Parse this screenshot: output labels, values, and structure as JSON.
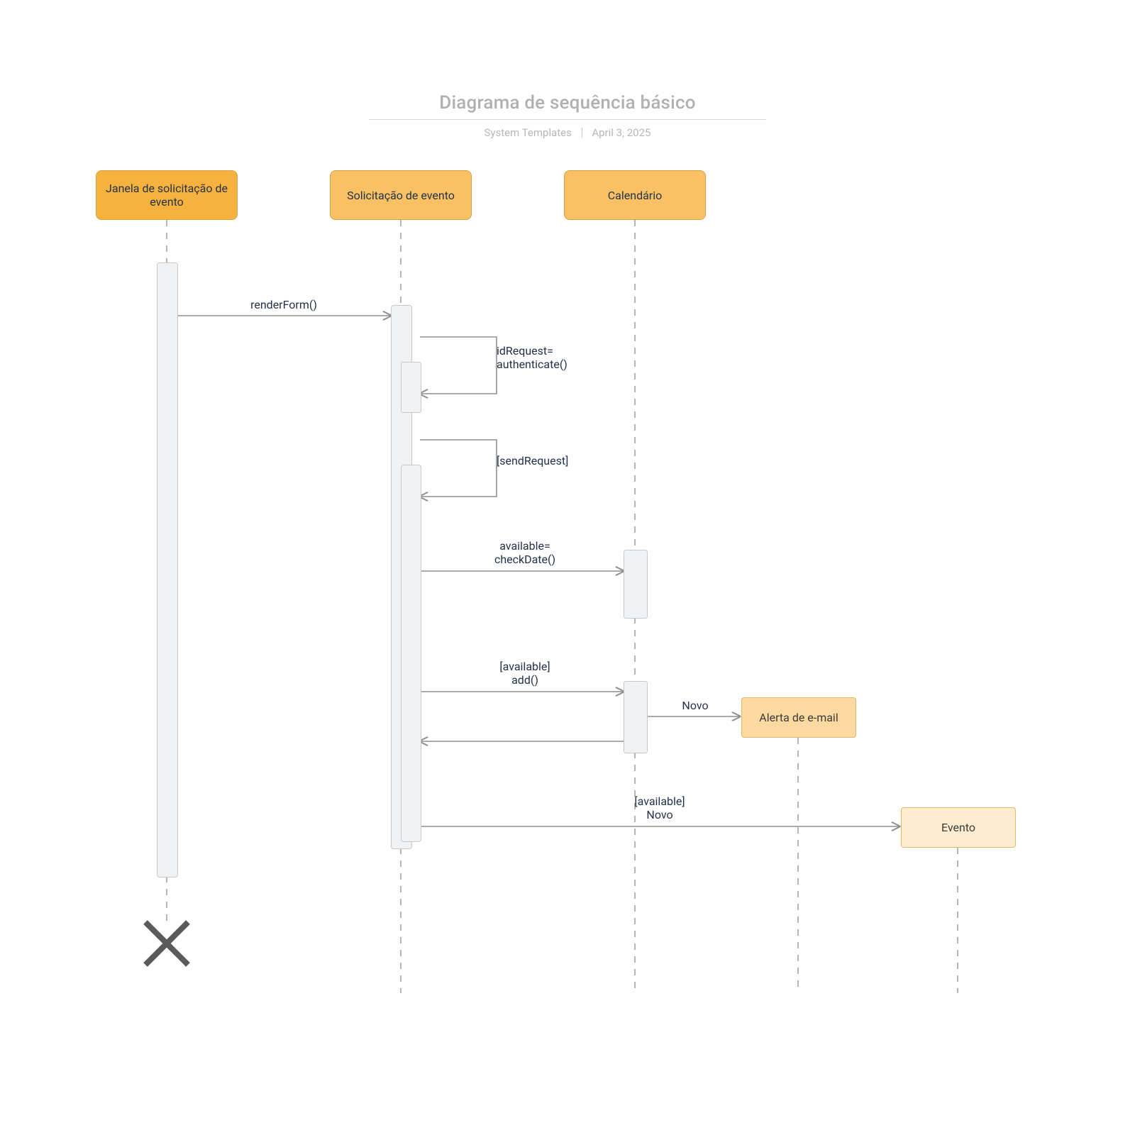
{
  "header": {
    "title": "Diagrama de sequência básico",
    "author": "System Templates",
    "date": "April 3, 2025"
  },
  "participants": {
    "p1": "Janela de solicitação de\nevento",
    "p2": "Solicitação de evento",
    "p3": "Calendário"
  },
  "objects": {
    "email": "Alerta de e-mail",
    "evento": "Evento"
  },
  "messages": {
    "m1": "renderForm()",
    "m2": "idRequest=\nauthenticate()",
    "m3": "[sendRequest]",
    "m4": "available=\ncheckDate()",
    "m5": "[available]\nadd()",
    "m6": "Novo",
    "m7": "[available]\nNovo"
  },
  "chart_data": {
    "type": "uml-sequence",
    "title": "Diagrama de sequência básico",
    "participants": [
      {
        "id": "p1",
        "name": "Janela de solicitação de evento"
      },
      {
        "id": "p2",
        "name": "Solicitação de evento"
      },
      {
        "id": "p3",
        "name": "Calendário"
      }
    ],
    "created_objects": [
      {
        "id": "email",
        "name": "Alerta de e-mail",
        "created_by": "p3",
        "create_message": "Novo"
      },
      {
        "id": "evento",
        "name": "Evento",
        "created_by": "p2",
        "create_message": "[available] Novo"
      }
    ],
    "messages": [
      {
        "from": "p1",
        "to": "p2",
        "label": "renderForm()",
        "type": "sync"
      },
      {
        "from": "p2",
        "to": "p2",
        "label": "idRequest= authenticate()",
        "type": "self"
      },
      {
        "from": "p2",
        "to": "p2",
        "label": "[sendRequest]",
        "type": "self"
      },
      {
        "from": "p2",
        "to": "p3",
        "label": "available= checkDate()",
        "type": "sync"
      },
      {
        "from": "p2",
        "to": "p3",
        "label": "[available] add()",
        "type": "sync"
      },
      {
        "from": "p3",
        "to": "p2",
        "label": "",
        "type": "return"
      },
      {
        "from": "p3",
        "to": "email",
        "label": "Novo",
        "type": "create"
      },
      {
        "from": "p2",
        "to": "evento",
        "label": "[available] Novo",
        "type": "create"
      }
    ],
    "destroyed": [
      "p1"
    ]
  }
}
